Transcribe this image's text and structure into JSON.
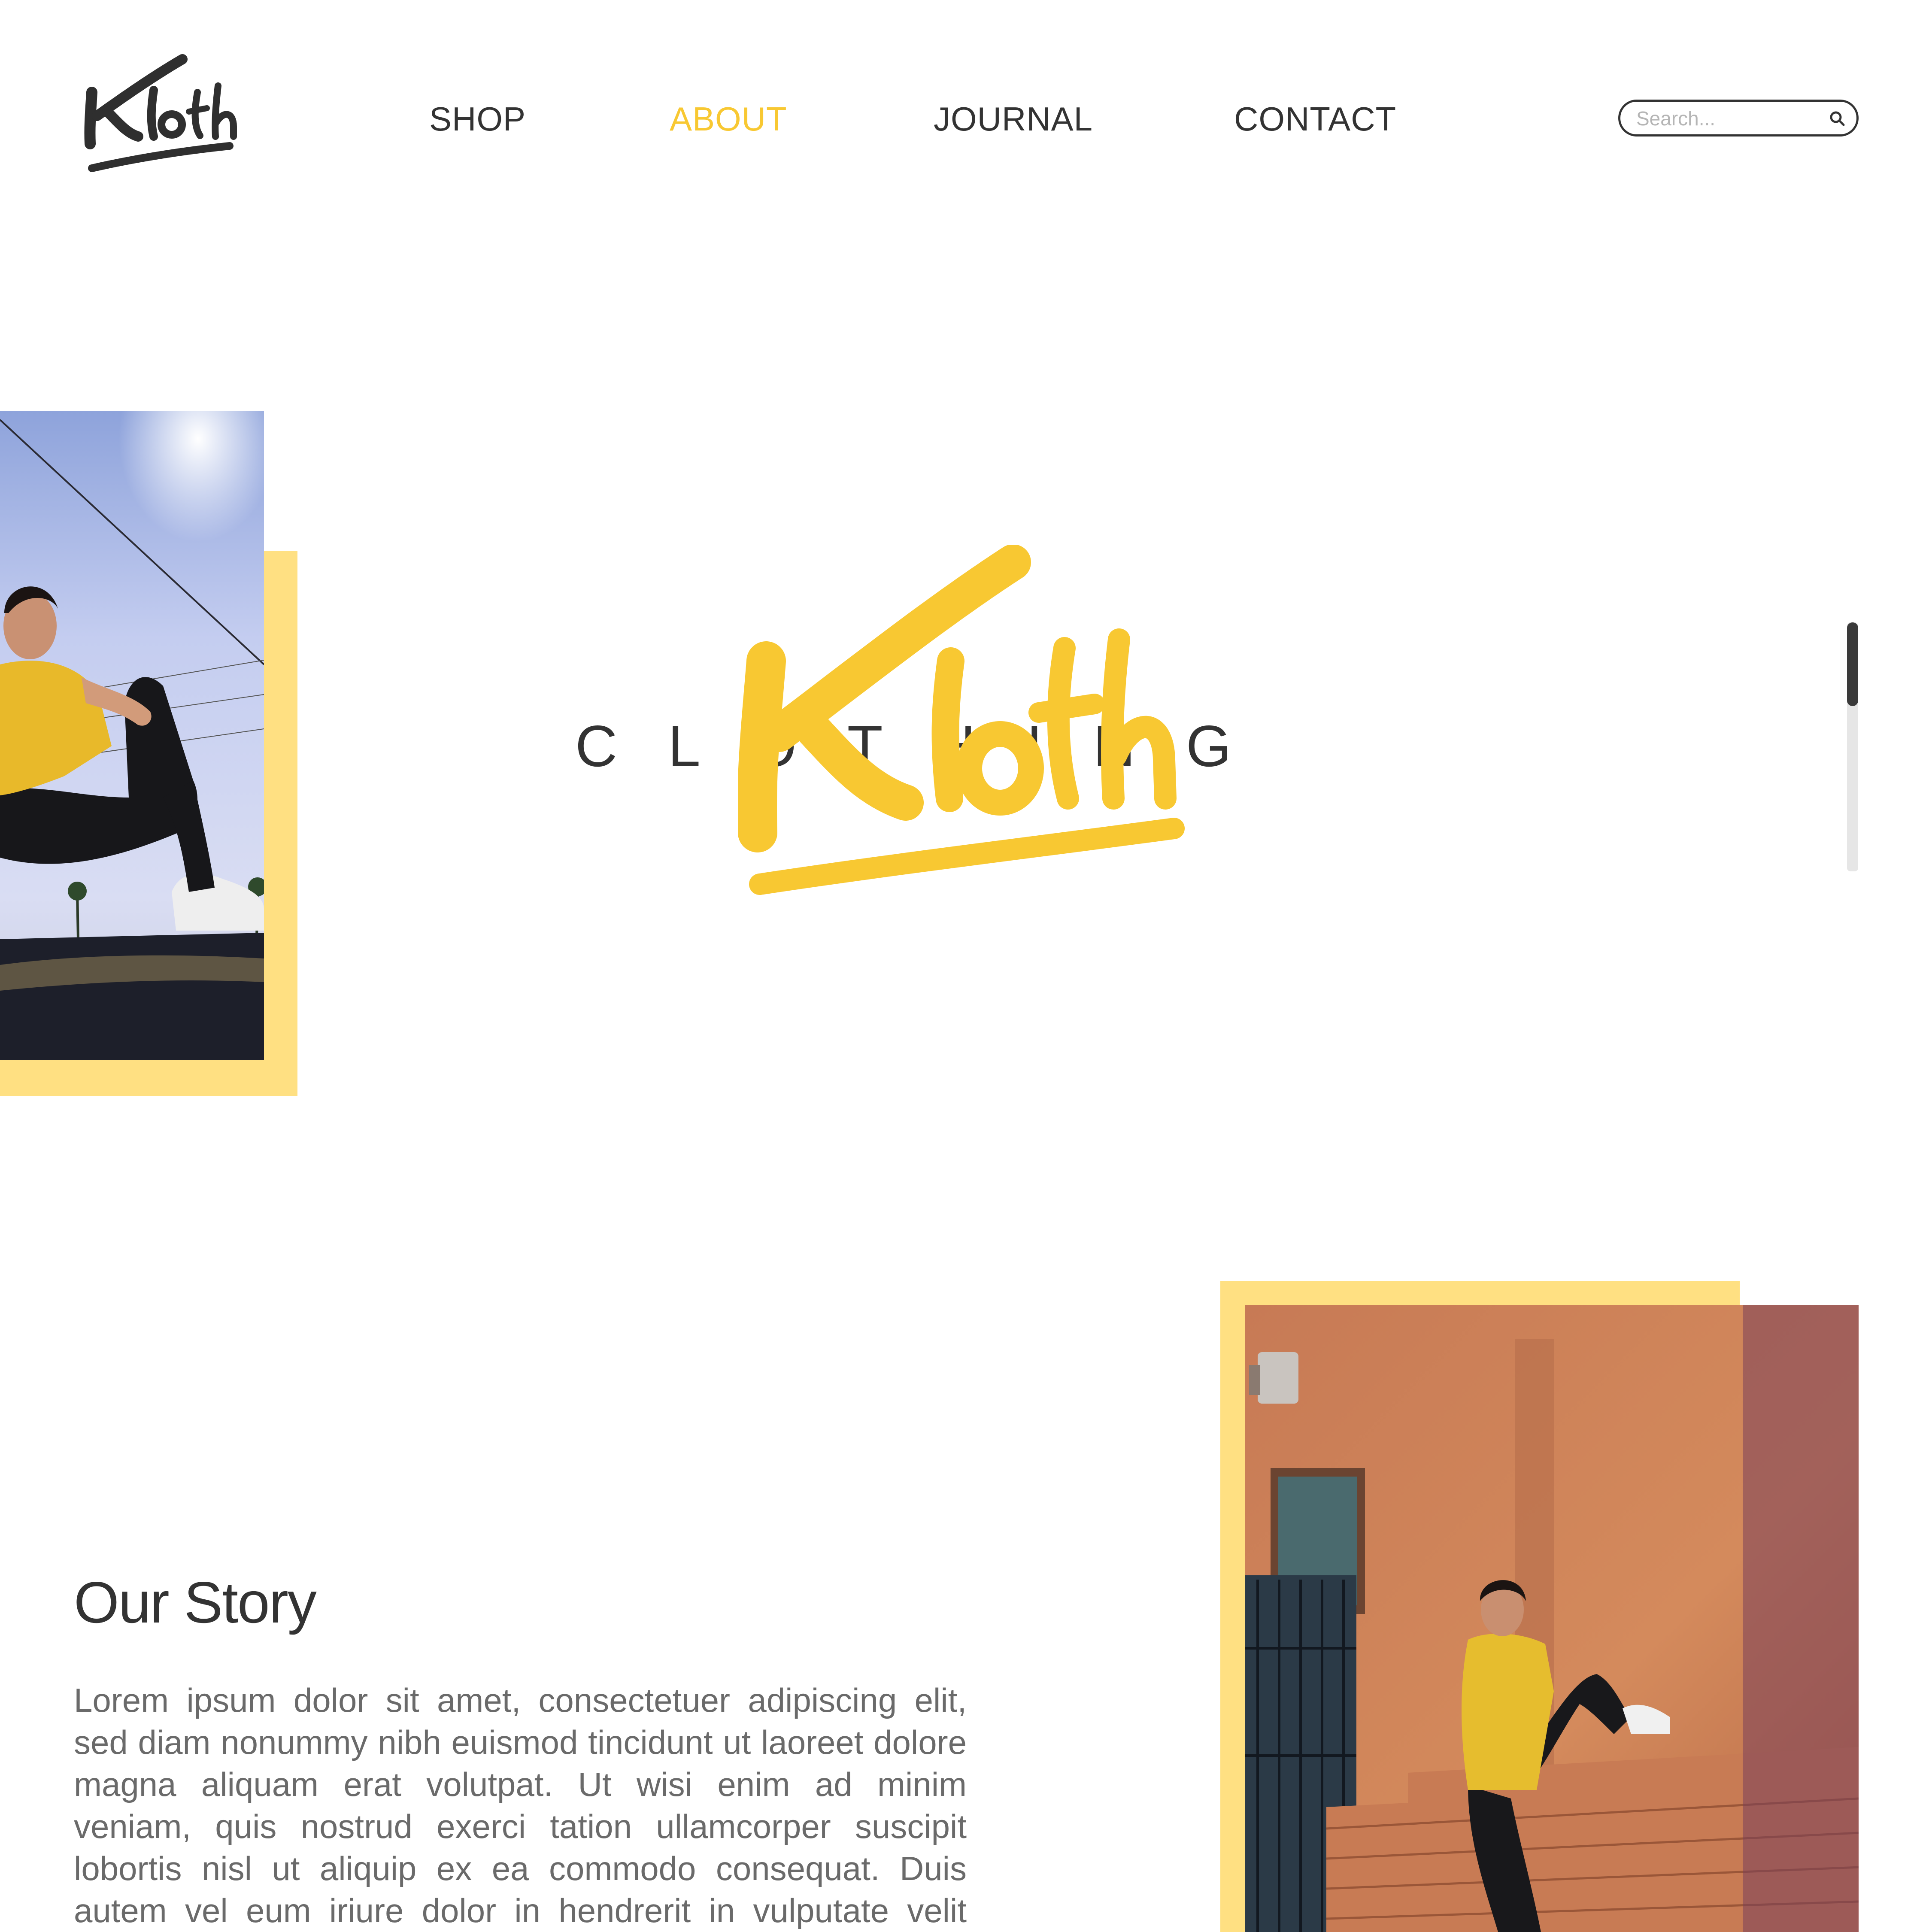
{
  "brand": {
    "logo_text": "Kloth",
    "tagline": "CLOTHING",
    "accent_color": "#f8c832",
    "frame_color": "#ffe082",
    "text_color": "#333333"
  },
  "nav": {
    "items": [
      {
        "label": "SHOP",
        "active": false
      },
      {
        "label": "ABOUT",
        "active": true
      },
      {
        "label": "JOURNAL",
        "active": false
      },
      {
        "label": "CONTACT",
        "active": false
      }
    ]
  },
  "search": {
    "placeholder": "Search...",
    "value": "",
    "icon": "search-icon"
  },
  "story": {
    "title": "Our Story",
    "body": "Lorem ipsum dolor sit amet, consectetuer adipiscing elit, sed diam nonummy nibh euismod tincidunt ut laoreet dolore magna aliquam erat volutpat. Ut wisi enim ad minim veniam, quis nostrud exerci tation ullamcorper suscipit lobortis nisl ut aliquip ex ea commodo consequat. Duis autem vel eum iriure dolor in hendrerit in vulputate velit esse molestie consequat,"
  },
  "scroll": {
    "position": 0
  }
}
